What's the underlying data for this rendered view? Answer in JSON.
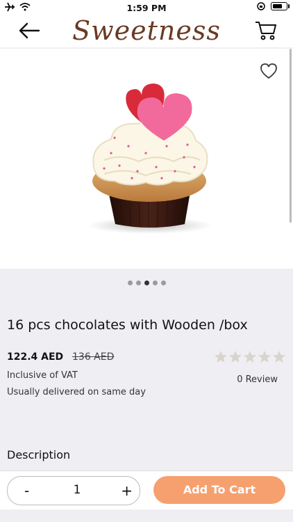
{
  "status_bar": {
    "time": "1:59 PM"
  },
  "header": {
    "logo_text": "Sweetness"
  },
  "product": {
    "title": "16 pcs chocolates with Wooden /box",
    "price": "122.4 AED",
    "old_price": "136 AED",
    "vat_text": "Inclusive of VAT",
    "delivery_text": "Usually delivered on same day",
    "review_text": "0 Review",
    "rating": 0,
    "max_rating": 5
  },
  "carousel": {
    "total": 5,
    "active_index": 2
  },
  "description_label": "Description",
  "cart_controls": {
    "minus": "-",
    "quantity": "1",
    "plus": "+",
    "add_to_cart": "Add To Cart"
  },
  "colors": {
    "accent": "#f6a06f",
    "logo": "#6a3a24",
    "star_empty": "#d9d4ce"
  }
}
